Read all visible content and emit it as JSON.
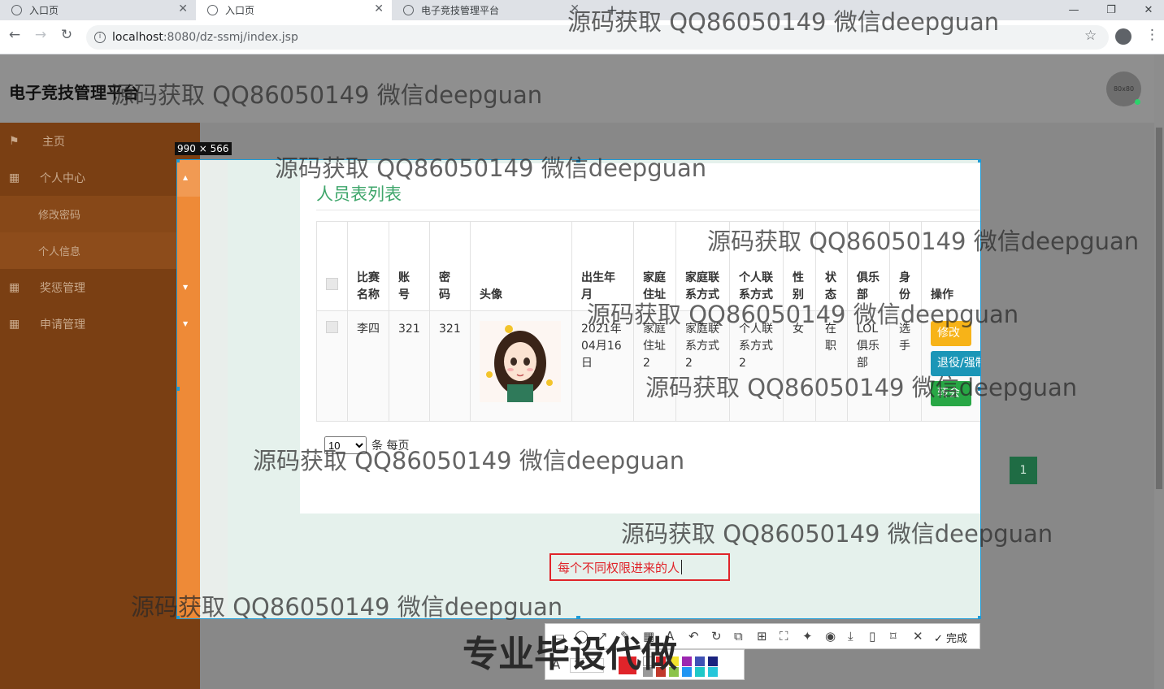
{
  "browser": {
    "tabs": [
      {
        "title": "入口页",
        "close": "✕"
      },
      {
        "title": "入口页",
        "close": "✕"
      },
      {
        "title": "电子竞技管理平台",
        "close": "✕"
      }
    ],
    "new_tab": "+",
    "url_host": "localhost",
    "url_path": ":8080/dz-ssmj/index.jsp",
    "controls": {
      "minimize": "—",
      "restore": "❐",
      "close": "✕"
    }
  },
  "header": {
    "brand": "电子竞技管理平台",
    "avatar_text": "80x80"
  },
  "sidebar": {
    "items": [
      {
        "label": "主页",
        "icon": "flag-icon"
      },
      {
        "label": "个人中心",
        "icon": "grid-icon"
      },
      {
        "label": "修改密码",
        "icon": ""
      },
      {
        "label": "个人信息",
        "icon": ""
      },
      {
        "label": "奖惩管理",
        "icon": "grid-icon"
      },
      {
        "label": "申请管理",
        "icon": "grid-icon"
      }
    ]
  },
  "capture": {
    "size_label": "990 × 566"
  },
  "card": {
    "title": "人员表列表",
    "columns": [
      "比赛名称",
      "账号",
      "密码",
      "头像",
      "出生年月",
      "家庭住址",
      "家庭联系方式",
      "个人联系方式",
      "性别",
      "状态",
      "俱乐部",
      "身份",
      "操作"
    ],
    "rows": [
      {
        "name": "李四",
        "account": "321",
        "password": "321",
        "birth": "2021年04月16日",
        "address": "家庭住址2",
        "home_contact": "家庭联系方式2",
        "personal_contact": "个人联系方式2",
        "gender": "女",
        "status": "在职",
        "club": "LOL俱乐部",
        "role": "选手",
        "actions": [
          "修改",
          "退役/强制退役",
          "转会"
        ]
      }
    ],
    "page_size": "10",
    "page_size_suffix": "条 每页",
    "current_page": "1"
  },
  "annotation": {
    "text": "每个不同权限进来的人"
  },
  "toolbar": {
    "done": "完成",
    "font_size": "12"
  },
  "watermarks": [
    "源码获取 QQ86050149 微信deepguan",
    "专业毕设代做"
  ],
  "colors": {
    "sidebar_orange": "#ee8a37",
    "title_green": "#3fa66b",
    "btn_edit": "#f7b318",
    "btn_retire": "#1b96b7",
    "btn_transfer": "#28a745",
    "annotation_red": "#e0242a"
  }
}
